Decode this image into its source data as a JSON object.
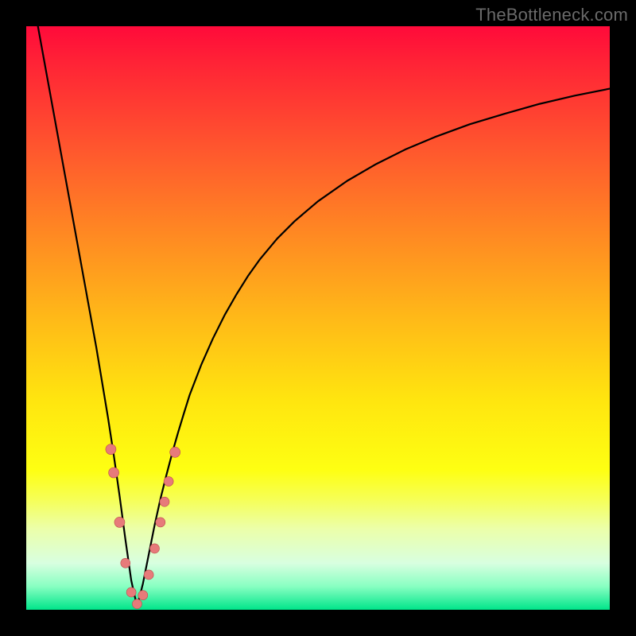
{
  "watermark": "TheBottleneck.com",
  "colors": {
    "frame": "#000000",
    "curve": "#000000",
    "marker_fill": "#e77a7a",
    "marker_stroke": "#bb4a4a"
  },
  "chart_data": {
    "type": "line",
    "title": "",
    "xlabel": "",
    "ylabel": "",
    "xlim": [
      0,
      100
    ],
    "ylim": [
      0,
      100
    ],
    "legend": false,
    "grid": false,
    "notch_x": 19,
    "series": [
      {
        "name": "bottleneck-curve",
        "x": [
          1,
          2,
          3,
          4,
          5,
          6,
          7,
          8,
          9,
          10,
          11,
          12,
          13,
          14,
          15,
          16,
          17,
          18,
          19,
          20,
          21,
          22,
          23,
          24,
          25,
          26,
          27,
          28,
          30,
          32,
          34,
          36,
          38,
          40,
          43,
          46,
          50,
          55,
          60,
          65,
          70,
          76,
          82,
          88,
          94,
          100
        ],
        "y": [
          106,
          100,
          94.5,
          89,
          83.5,
          78,
          72.5,
          67,
          61.5,
          56,
          50.5,
          45,
          39,
          33,
          26.5,
          19.5,
          12,
          5,
          0.5,
          4.5,
          9.5,
          14.5,
          19,
          23,
          26.8,
          30.3,
          33.6,
          36.8,
          42,
          46.5,
          50.5,
          54,
          57.2,
          60,
          63.6,
          66.6,
          70,
          73.5,
          76.4,
          78.9,
          81,
          83.2,
          85,
          86.7,
          88.1,
          89.3
        ]
      }
    ],
    "markers": [
      {
        "x": 14.5,
        "y": 27.5,
        "r": 6.5
      },
      {
        "x": 15.0,
        "y": 23.5,
        "r": 6.5
      },
      {
        "x": 16.0,
        "y": 15.0,
        "r": 6.5
      },
      {
        "x": 17.0,
        "y": 8.0,
        "r": 6.0
      },
      {
        "x": 18.0,
        "y": 3.0,
        "r": 6.0
      },
      {
        "x": 19.0,
        "y": 1.0,
        "r": 6.0
      },
      {
        "x": 20.0,
        "y": 2.5,
        "r": 6.0
      },
      {
        "x": 21.0,
        "y": 6.0,
        "r": 6.0
      },
      {
        "x": 22.0,
        "y": 10.5,
        "r": 6.0
      },
      {
        "x": 23.0,
        "y": 15.0,
        "r": 6.0
      },
      {
        "x": 23.7,
        "y": 18.5,
        "r": 6.0
      },
      {
        "x": 24.4,
        "y": 22.0,
        "r": 6.0
      },
      {
        "x": 25.5,
        "y": 27.0,
        "r": 6.5
      }
    ]
  }
}
